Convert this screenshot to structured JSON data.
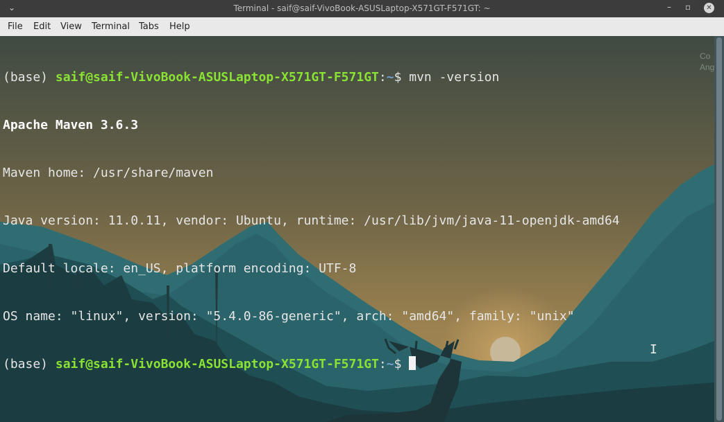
{
  "window": {
    "title": "Terminal - saif@saif-VivoBook-ASUSLaptop-X571GT-F571GT: ~",
    "controls": {
      "minimize": "–",
      "restore": "▫",
      "maximize": "▫",
      "close": "✕"
    }
  },
  "menu": [
    "File",
    "Edit",
    "View",
    "Terminal",
    "Tabs",
    "Help"
  ],
  "terminal": {
    "prompt_env": "(base)",
    "prompt_user": "saif@saif-VivoBook-ASUSLaptop-X571GT-F571GT",
    "prompt_sep": ":",
    "prompt_path": "~",
    "prompt_symbol": "$",
    "command": "mvn -version",
    "output": [
      "Apache Maven 3.6.3",
      "Maven home: /usr/share/maven",
      "Java version: 11.0.11, vendor: Ubuntu, runtime: /usr/lib/jvm/java-11-openjdk-amd64",
      "Default locale: en_US, platform encoding: UTF-8",
      "OS name: \"linux\", version: \"5.4.0-86-generic\", arch: \"amd64\", family: \"unix\""
    ]
  },
  "desktop_partial": {
    "line1": "Co",
    "line2": "Ang"
  },
  "colors": {
    "prompt_user": "#8ae234",
    "prompt_path": "#729fcf",
    "text": "#e6e6e6",
    "titlebar": "#3c3c3c",
    "menubar": "#e9e9e9"
  }
}
